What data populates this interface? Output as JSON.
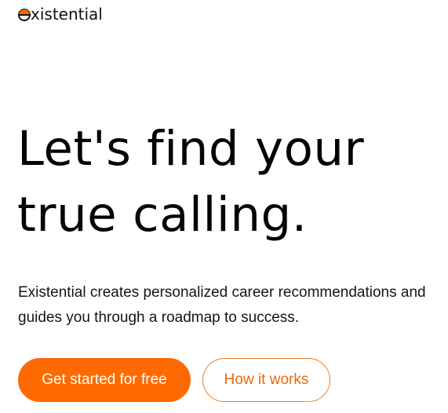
{
  "brand": {
    "name": "xistential",
    "accent_color": "#ff6a00"
  },
  "hero": {
    "title_line1": "Let's find your",
    "title_line2": "true calling.",
    "subtitle": "Existential creates personalized career recommendations and guides you through a roadmap to success."
  },
  "actions": {
    "primary_label": "Get started for free",
    "secondary_label": "How it works"
  }
}
